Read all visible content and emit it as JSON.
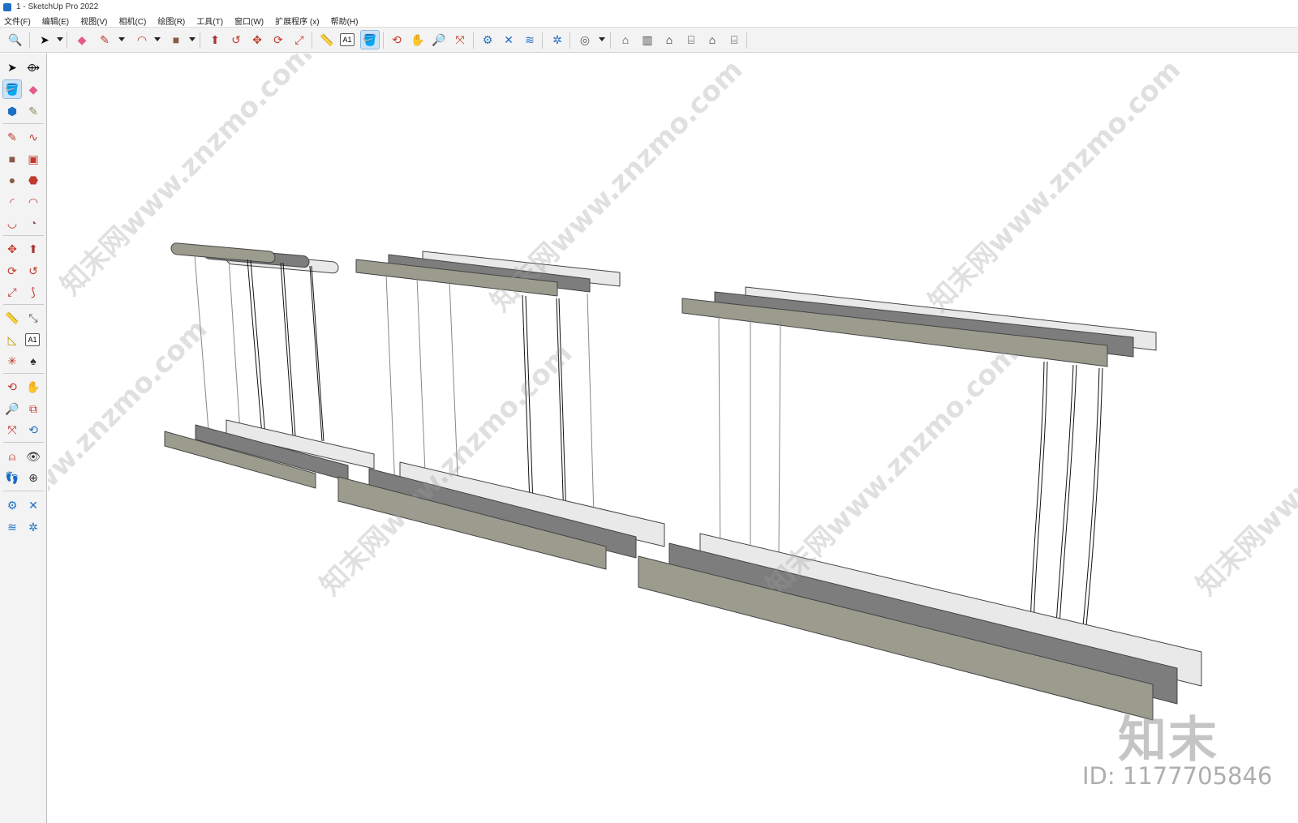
{
  "window": {
    "title": "1 - SketchUp Pro 2022"
  },
  "menu": [
    "文件(F)",
    "编辑(E)",
    "视图(V)",
    "相机(C)",
    "绘图(R)",
    "工具(T)",
    "窗口(W)",
    "扩展程序 (x)",
    "帮助(H)"
  ],
  "toolbar": {
    "text_tool_label": "A1"
  },
  "left_toolbar": {
    "text_tool_label": "A1"
  },
  "watermark": {
    "site_text": "知末网www.znzmo.com",
    "brand": "知末",
    "id_text": "ID: 1177705846"
  },
  "colors": {
    "accent": "#1f6fc2",
    "active_tool_bg": "#cce3f7",
    "fixture_taupe": "#9b9b8e",
    "fixture_dark": "#7d7d7d",
    "fixture_white": "#e9e9e9"
  }
}
